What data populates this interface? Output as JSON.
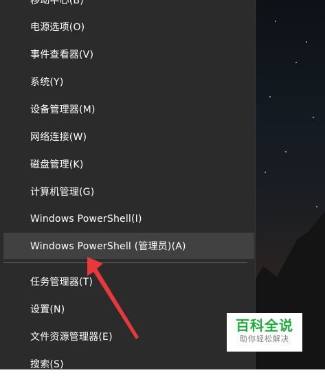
{
  "menu": {
    "items": [
      {
        "label": "移动中心(B)"
      },
      {
        "label": "电源选项(O)"
      },
      {
        "label": "事件查看器(V)"
      },
      {
        "label": "系统(Y)"
      },
      {
        "label": "设备管理器(M)"
      },
      {
        "label": "网络连接(W)"
      },
      {
        "label": "磁盘管理(K)"
      },
      {
        "label": "计算机管理(G)"
      },
      {
        "label": "Windows PowerShell(I)"
      },
      {
        "label": "Windows PowerShell (管理员)(A)"
      },
      {
        "label": "任务管理器(T)"
      },
      {
        "label": "设置(N)"
      },
      {
        "label": "文件资源管理器(E)"
      },
      {
        "label": "搜索(S)"
      }
    ]
  },
  "watermark": {
    "title": "百科全说",
    "subtitle": "助你轻松解决"
  },
  "colors": {
    "menu_bg": "#2b2b2b",
    "highlight_bg": "#414141",
    "arrow": "#e8383b",
    "watermark_green": "#1fab3c"
  }
}
